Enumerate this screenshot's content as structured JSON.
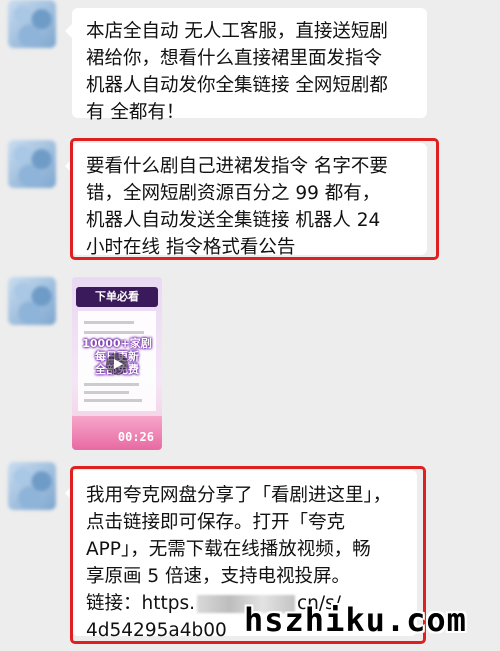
{
  "messages": [
    {
      "lines": [
        "本店全自动 无人工客服，直接送短剧",
        "裙给你，想看什么直接裙里面发指令",
        "机器人自动发你全集链接 全网短剧都",
        "有 全都有！"
      ]
    },
    {
      "lines": [
        "要看什么剧自己进裙发指令 名字不要",
        "错，全网短剧资源百分之 99 都有，",
        "机器人自动发送全集链接 机器人 24",
        "小时在线 指令格式看公告"
      ]
    },
    {
      "video": {
        "banner": "下单必看",
        "overlay": [
          "10000+家剧",
          "每日更新",
          "全部免费"
        ],
        "duration": "00:26"
      }
    },
    {
      "lines": [
        "我用夸克网盘分享了「看剧进这里」，",
        "点击链接即可保存。打开「夸克",
        "APP」，无需下载在线播放视频，畅",
        "享原画 5 倍速，支持电视投屏。"
      ],
      "link_prefix": "链接：https.",
      "link_suffix": "cn/s/",
      "link_code": "4d54295a4b00"
    }
  ],
  "watermark": "hszhiku.com"
}
